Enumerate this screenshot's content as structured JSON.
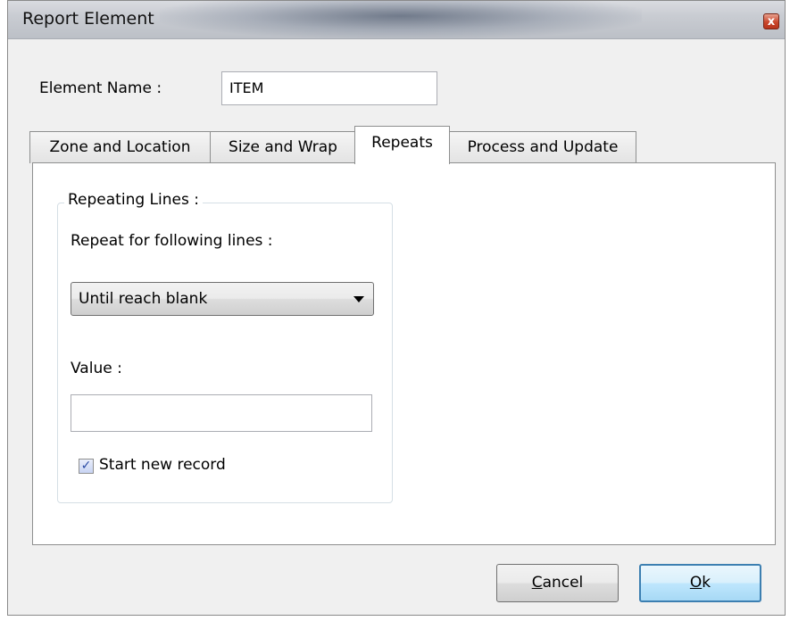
{
  "window": {
    "title": "Report Element",
    "close_icon": "close-icon",
    "close_glyph": "x"
  },
  "element_name": {
    "label": "Element Name :",
    "value": "ITEM"
  },
  "tabs": [
    {
      "label": "Zone and Location",
      "active": false
    },
    {
      "label": "Size and Wrap",
      "active": false
    },
    {
      "label": "Repeats",
      "active": true
    },
    {
      "label": "Process and Update",
      "active": false
    }
  ],
  "repeats": {
    "group_title": "Repeating Lines :",
    "repeat_label": "Repeat for following lines :",
    "repeat_selected": "Until reach blank",
    "value_label": "Value :",
    "value": "",
    "start_new_record_label": "Start new record",
    "start_new_record_checked": true,
    "check_glyph": "✓"
  },
  "buttons": {
    "cancel_first": "C",
    "cancel_rest": "ancel",
    "ok_first": "O",
    "ok_rest": "k"
  },
  "colors": {
    "default_button_border": "#3c7fb1",
    "close_button": "#c9472c"
  }
}
